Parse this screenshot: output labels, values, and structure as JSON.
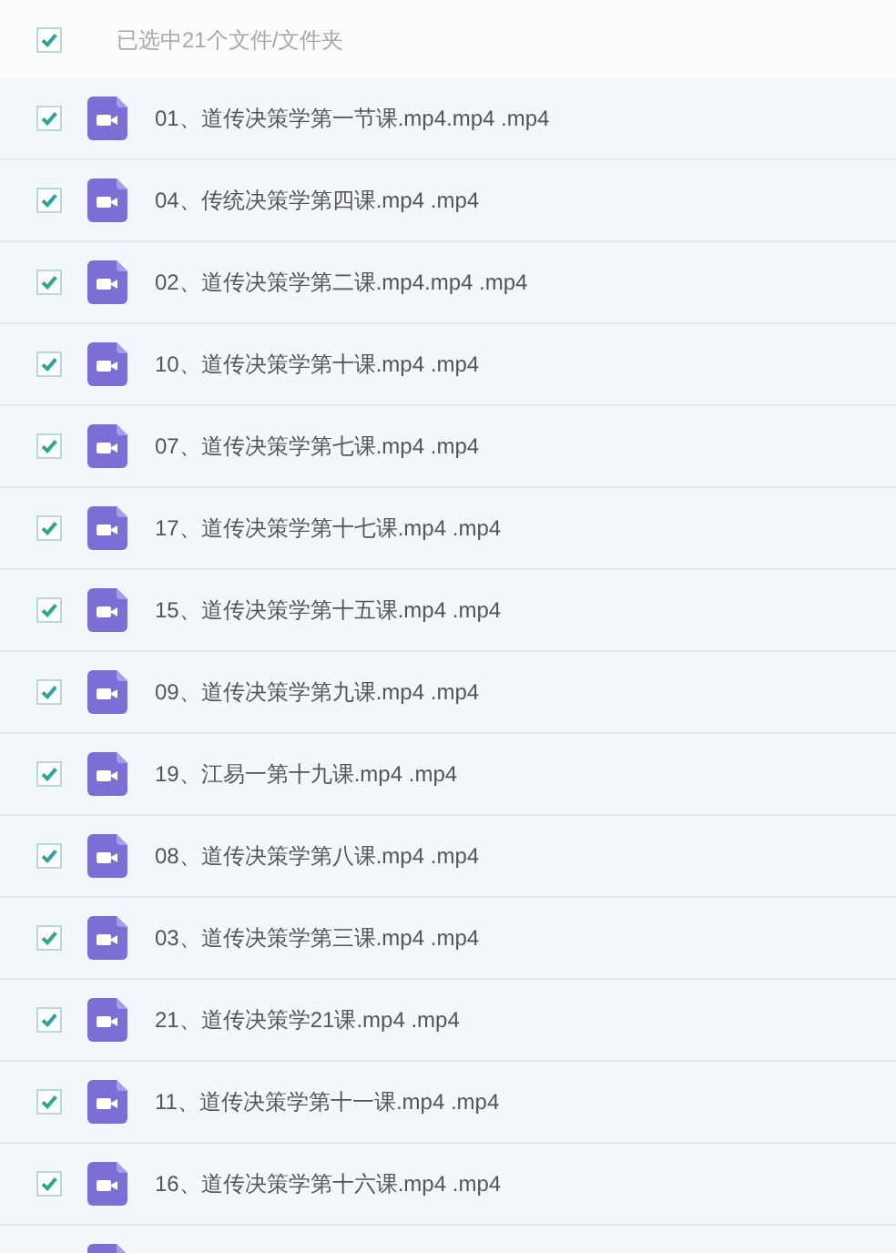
{
  "header": {
    "label": "已选中21个文件/文件夹",
    "checked": true
  },
  "files": [
    {
      "name": "01、道传决策学第一节课.mp4.mp4 .mp4",
      "checked": true
    },
    {
      "name": "04、传统决策学第四课.mp4 .mp4",
      "checked": true
    },
    {
      "name": "02、道传决策学第二课.mp4.mp4 .mp4",
      "checked": true
    },
    {
      "name": "10、道传决策学第十课.mp4 .mp4",
      "checked": true
    },
    {
      "name": "07、道传决策学第七课.mp4 .mp4",
      "checked": true
    },
    {
      "name": "17、道传决策学第十七课.mp4 .mp4",
      "checked": true
    },
    {
      "name": "15、道传决策学第十五课.mp4 .mp4",
      "checked": true
    },
    {
      "name": "09、道传决策学第九课.mp4 .mp4",
      "checked": true
    },
    {
      "name": "19、江易一第十九课.mp4 .mp4",
      "checked": true
    },
    {
      "name": "08、道传决策学第八课.mp4 .mp4",
      "checked": true
    },
    {
      "name": "03、道传决策学第三课.mp4 .mp4",
      "checked": true
    },
    {
      "name": "21、道传决策学21课.mp4 .mp4",
      "checked": true
    },
    {
      "name": "11、道传决策学第十一课.mp4 .mp4",
      "checked": true
    },
    {
      "name": "16、道传决策学第十六课.mp4 .mp4",
      "checked": true
    }
  ]
}
